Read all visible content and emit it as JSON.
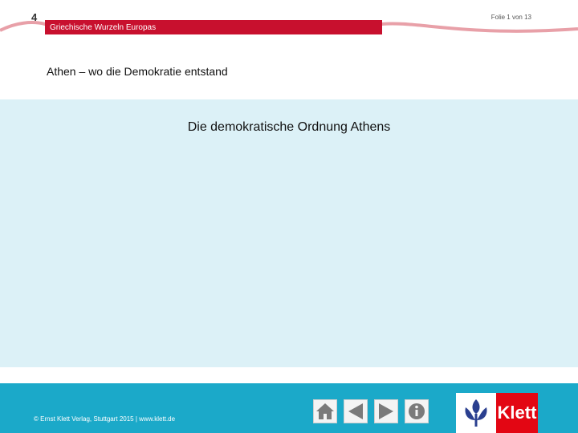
{
  "header": {
    "chapter_number": "4",
    "chapter_title": "Griechische Wurzeln Europas",
    "slide_counter": "Folie 1 von 13",
    "section_title": "Athen – wo die Demokratie entstand"
  },
  "main": {
    "heading": "Die demokratische Ordnung Athens"
  },
  "footer": {
    "copyright": "© Ernst Klett Verlag, Stuttgart 2015 | www.klett.de",
    "nav": {
      "home_icon": "home-icon",
      "prev_icon": "triangle-left-icon",
      "next_icon": "triangle-right-icon",
      "info_icon": "info-icon"
    },
    "logo_text": "Klett"
  },
  "colors": {
    "accent_red": "#c8102e",
    "content_bg": "#dcf1f7",
    "footer_bg": "#1ba9c9",
    "logo_red": "#e30613"
  }
}
